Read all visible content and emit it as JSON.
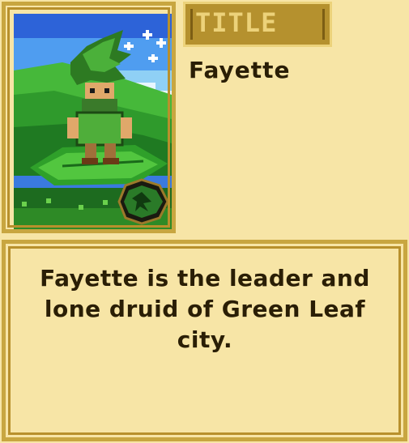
{
  "title_tag": "TITLE",
  "card": {
    "name": "Fayette",
    "element_icon": "leaf-emblem-icon",
    "description": "Fayette is the leader and lone druid of Green Leaf city."
  },
  "colors": {
    "panel_bg": "#f7e5a6",
    "frame_gold": "#c8a640",
    "frame_dark": "#b8902c",
    "text_dark": "#2a1e05",
    "title_tag_bg": "#b5912e",
    "title_tag_text": "#ecd27a"
  }
}
